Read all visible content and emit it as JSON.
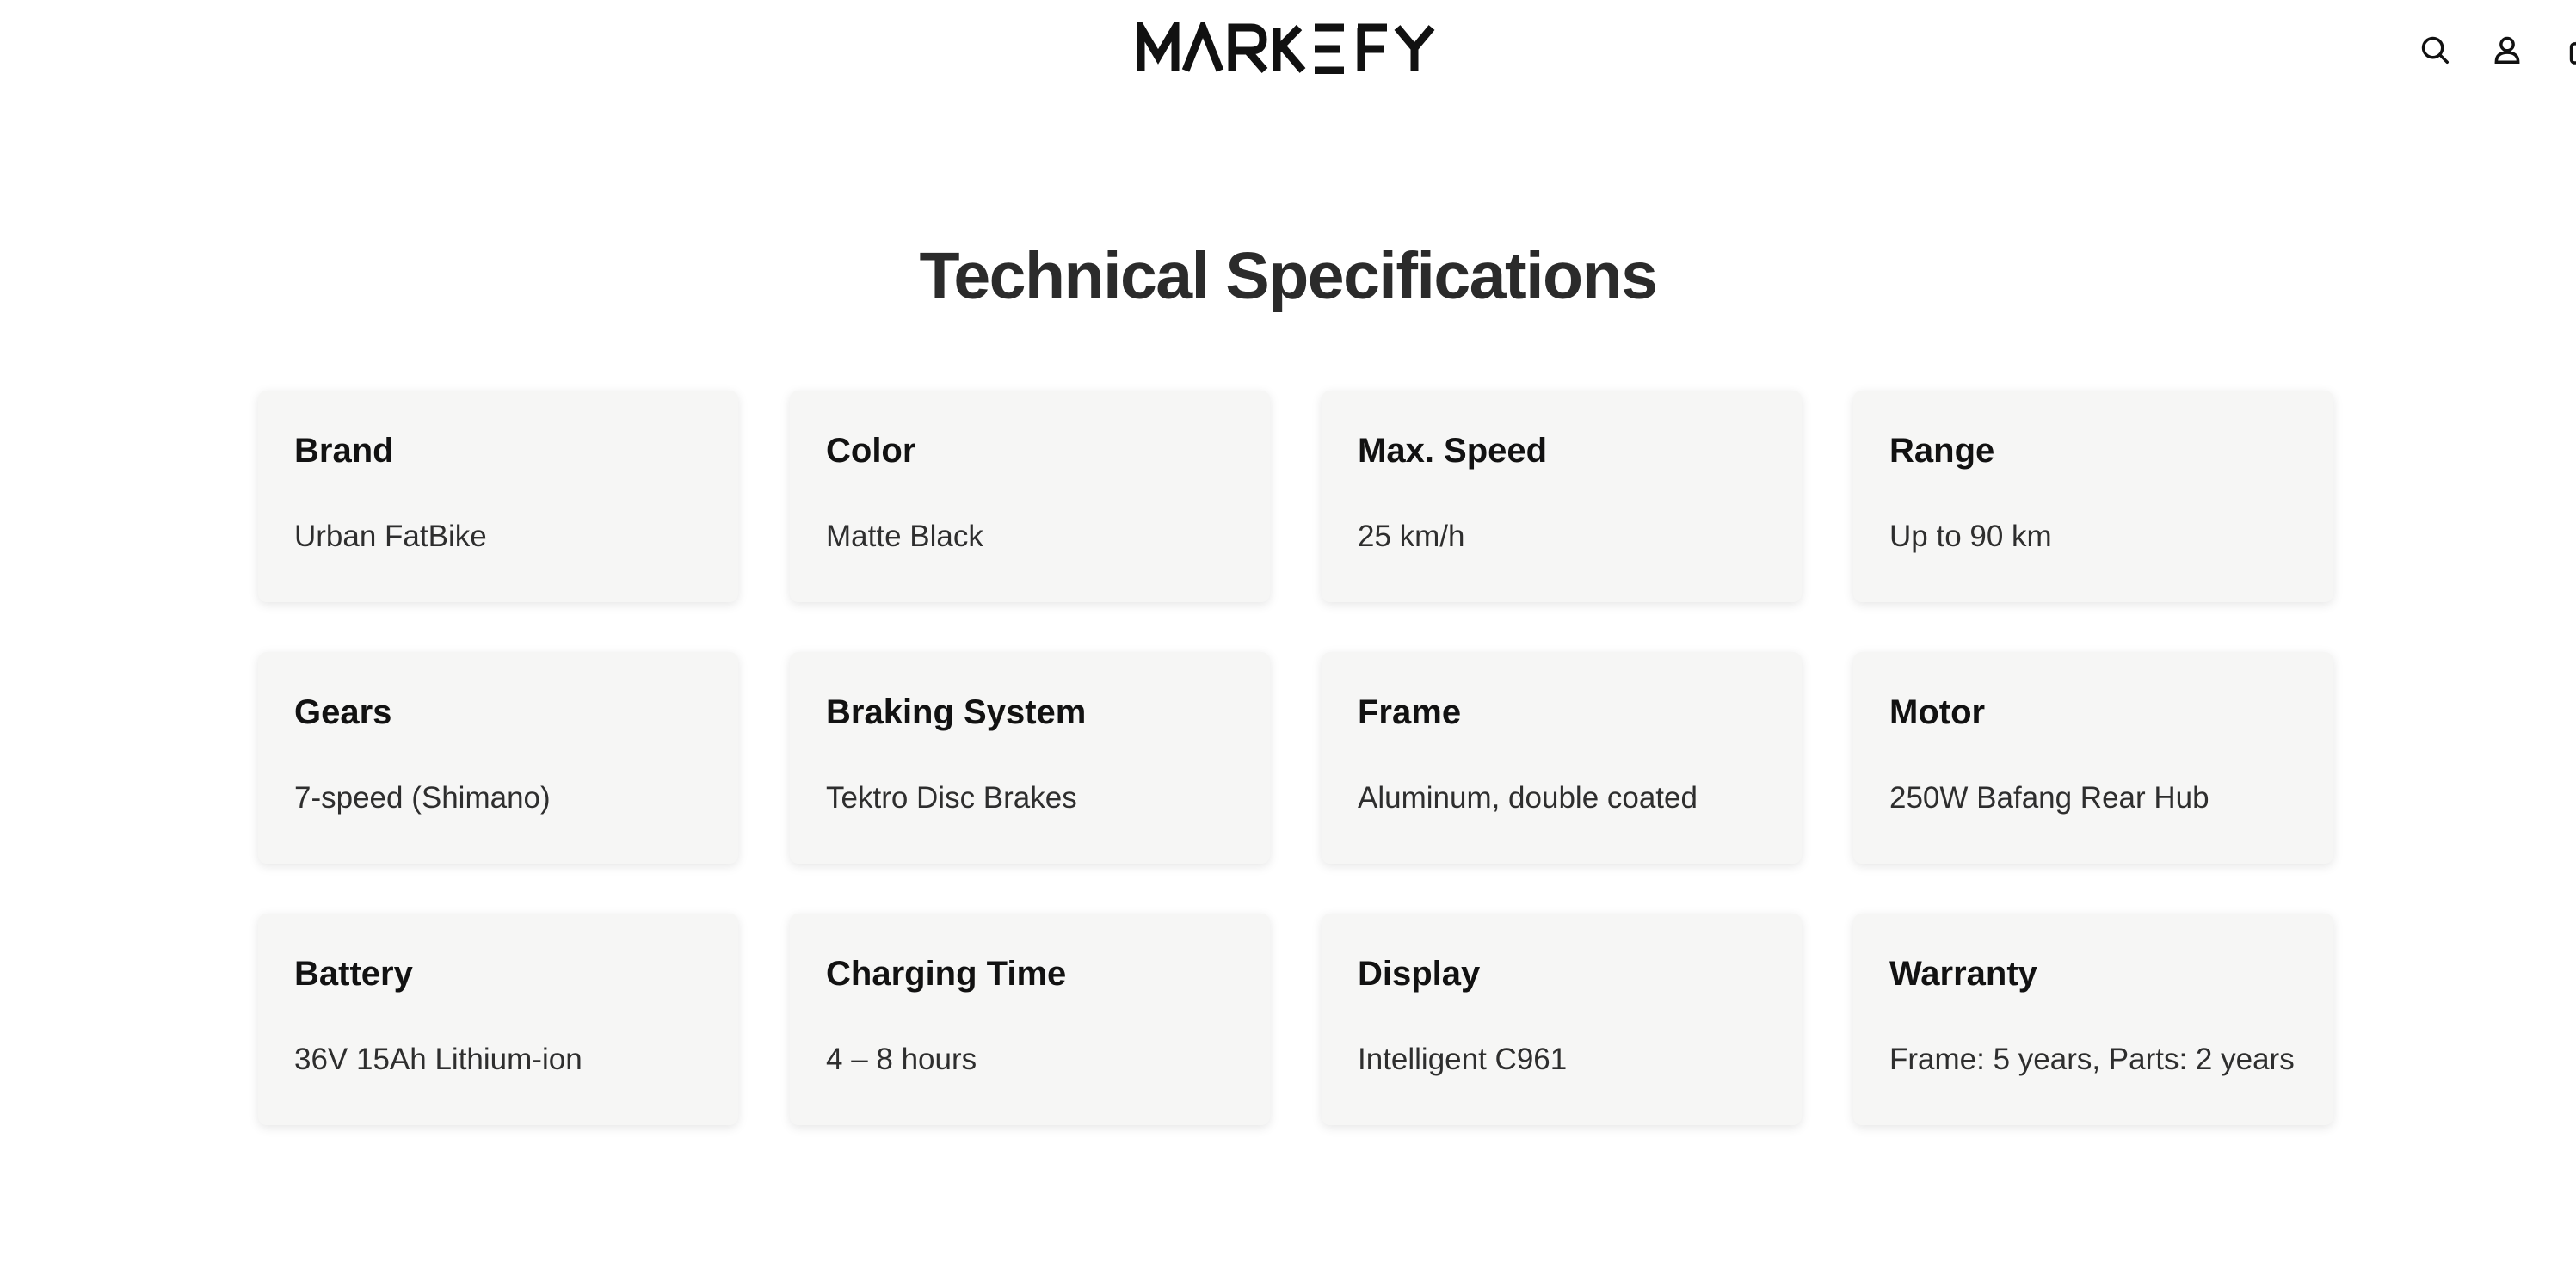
{
  "header": {
    "logo_text": "MARKEFY",
    "icons": [
      "search-icon",
      "account-icon",
      "cart-icon"
    ]
  },
  "main": {
    "title": "Technical Specifications",
    "specs": [
      {
        "label": "Brand",
        "value": "Urban FatBike"
      },
      {
        "label": "Color",
        "value": "Matte Black"
      },
      {
        "label": "Max. Speed",
        "value": "25 km/h"
      },
      {
        "label": "Range",
        "value": "Up to 90 km"
      },
      {
        "label": "Gears",
        "value": "7-speed (Shimano)"
      },
      {
        "label": "Braking System",
        "value": "Tektro Disc Brakes"
      },
      {
        "label": "Frame",
        "value": "Aluminum, double coated"
      },
      {
        "label": "Motor",
        "value": "250W Bafang Rear Hub"
      },
      {
        "label": "Battery",
        "value": "36V 15Ah Lithium-ion"
      },
      {
        "label": "Charging Time",
        "value": "4 – 8 hours"
      },
      {
        "label": "Display",
        "value": "Intelligent C961"
      },
      {
        "label": "Warranty",
        "value": "Frame: 5 years, Parts: 2 years"
      }
    ]
  },
  "colors": {
    "card_background": "#f6f6f5",
    "title": "#2b2b2b",
    "text": "#121212"
  }
}
